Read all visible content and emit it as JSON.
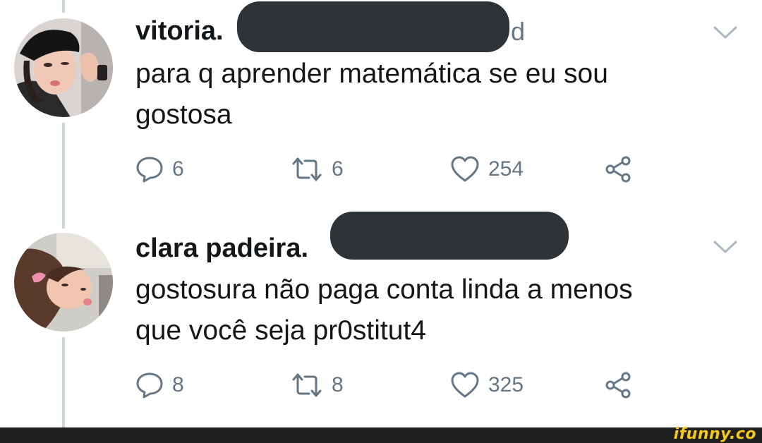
{
  "tweets": [
    {
      "name": "vitoria.",
      "handle_tail": "d",
      "text": "para q aprender matemática se eu sou\ngostosa",
      "replies": "6",
      "retweets": "6",
      "likes": "254"
    },
    {
      "name": "clara padeira.",
      "handle_tail": "",
      "text": "gostosura não paga conta linda a menos\nque você seja pr0stitut4",
      "replies": "8",
      "retweets": "8",
      "likes": "325"
    }
  ],
  "watermark": "ifunny.co",
  "colors": {
    "name": "#14171a",
    "muted": "#657786",
    "thread_line": "#ccd6dd",
    "redaction": "#2e3338",
    "watermark": "#f6c915"
  }
}
